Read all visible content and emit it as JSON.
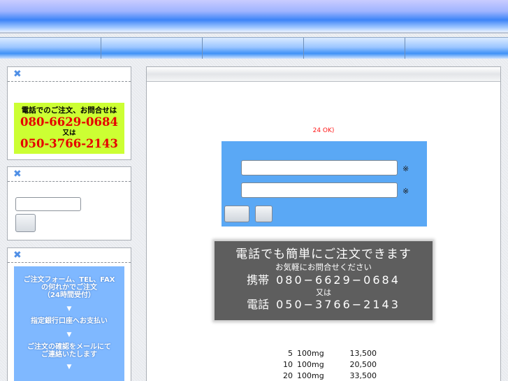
{
  "colors": {
    "header_blue": "#3d84f7",
    "phone_badge_bg": "#ccff33",
    "phone_number_red": "#e60000",
    "flow_panel_bg": "#7fb8ff",
    "form_panel_bg": "#5aa8f5",
    "banner_bg": "#5e5e5e",
    "notice_red": "#ff1a1a"
  },
  "icons": {
    "box_header": "x-mark-icon"
  },
  "sidebar": {
    "phone_box": {
      "icon_glyph": "✖",
      "line1": "電話でのご注文、お問合せは",
      "number1": "080-6629-0684",
      "or_text": "又は",
      "number2": "050-3766-2143"
    },
    "search_box": {
      "icon_glyph": "✖",
      "input_value": "",
      "button_label": ""
    },
    "flow_box": {
      "icon_glyph": "✖",
      "step1_line1": "ご注文フォーム、TEL、FAX",
      "step1_line2": "の何れかでご注文",
      "step1_line3": "（24時間受付）",
      "arrow": "▼",
      "step2": "指定銀行口座へお支払い",
      "step3_line1": "ご注文の確認をメールにて",
      "step3_line2": "ご連絡いたします",
      "arrow_bottom": "▼"
    }
  },
  "main": {
    "notice": "24 OK)",
    "form": {
      "field1_value": "",
      "field2_value": "",
      "required_mark": "※",
      "button1_label": "",
      "button2_label": ""
    },
    "banner": {
      "line1": "電話でも簡単にご注文できます",
      "line2": "お気軽にお問合せください",
      "mobile_label": "携帯",
      "mobile_number": "080−6629−0684",
      "or_text": "又は",
      "tel_label": "電話",
      "tel_number": "050−3766−2143"
    },
    "prices": [
      {
        "qty": "5",
        "dose": "100mg",
        "price": "13,500"
      },
      {
        "qty": "10",
        "dose": "100mg",
        "price": "20,500"
      },
      {
        "qty": "20",
        "dose": "100mg",
        "price": "33,500"
      }
    ]
  }
}
